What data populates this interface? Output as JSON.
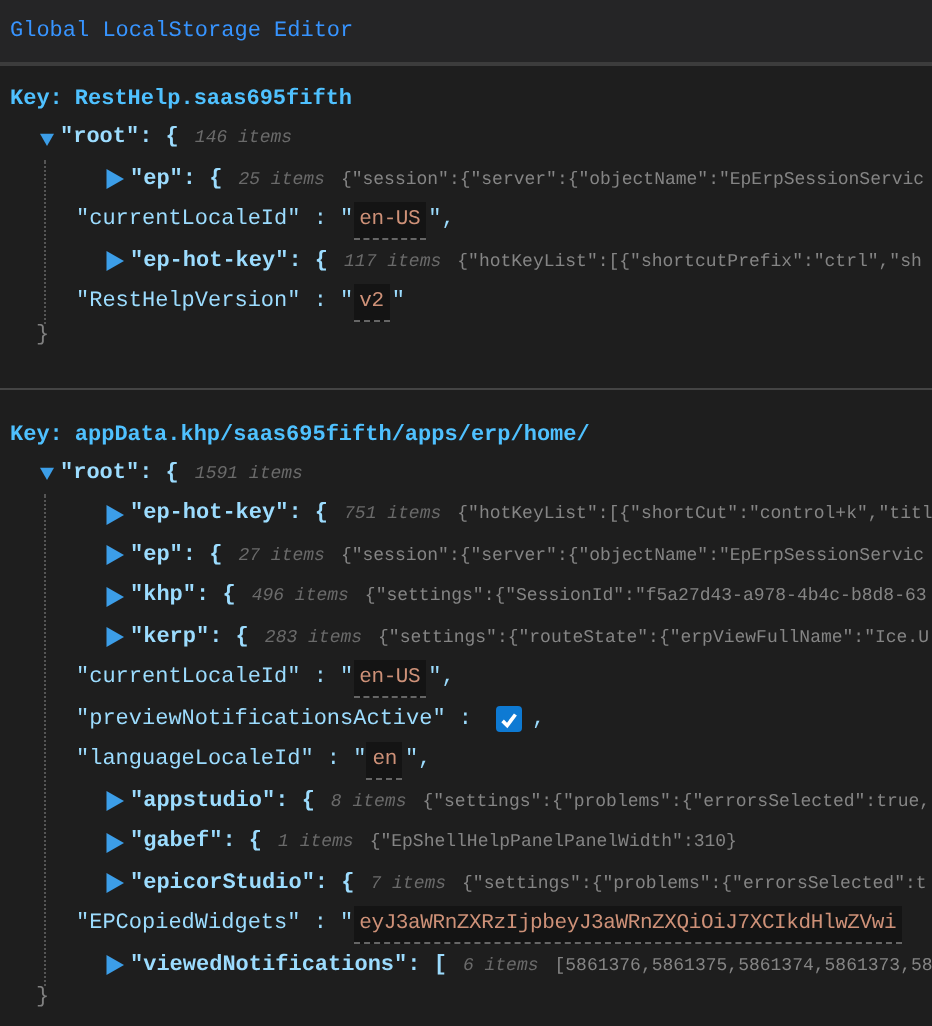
{
  "title": "Global LocalStorage Editor",
  "sections": [
    {
      "key_label": "Key:",
      "key": "RestHelp.saas695fifth",
      "root": {
        "label": "\"root\": {",
        "count": "146 items",
        "expanded": true
      },
      "close": "}",
      "items": [
        {
          "kind": "object",
          "label": "\"ep\": {",
          "count": "25 items",
          "expanded": false,
          "preview": "{\"session\":{\"server\":{\"objectName\":\"EpErpSessionServic"
        },
        {
          "kind": "string",
          "label": "\"currentLocaleId\" : \"",
          "value": "en-US",
          "suffix": "\","
        },
        {
          "kind": "object",
          "label": "\"ep-hot-key\": {",
          "count": "117 items",
          "expanded": false,
          "preview": "{\"hotKeyList\":[{\"shortcutPrefix\":\"ctrl\",\"sh"
        },
        {
          "kind": "string",
          "label": "\"RestHelpVersion\" : \"",
          "value": "v2",
          "suffix": "\""
        }
      ]
    },
    {
      "key_label": "Key:",
      "key": "appData.khp/saas695fifth/apps/erp/home/",
      "root": {
        "label": "\"root\": {",
        "count": "1591 items",
        "expanded": true
      },
      "close": "}",
      "items": [
        {
          "kind": "object",
          "label": "\"ep-hot-key\": {",
          "count": "751 items",
          "expanded": false,
          "preview": "{\"hotKeyList\":[{\"shortCut\":\"control+k\",\"titl"
        },
        {
          "kind": "object",
          "label": "\"ep\": {",
          "count": "27 items",
          "expanded": false,
          "preview": "{\"session\":{\"server\":{\"objectName\":\"EpErpSessionServic"
        },
        {
          "kind": "object",
          "label": "\"khp\": {",
          "count": "496 items",
          "expanded": false,
          "preview": "{\"settings\":{\"SessionId\":\"f5a27d43-a978-4b4c-b8d8-63"
        },
        {
          "kind": "object",
          "label": "\"kerp\": {",
          "count": "283 items",
          "expanded": false,
          "preview": "{\"settings\":{\"routeState\":{\"erpViewFullName\":\"Ice.U"
        },
        {
          "kind": "string",
          "label": "\"currentLocaleId\" : \"",
          "value": "en-US",
          "suffix": "\","
        },
        {
          "kind": "boolean",
          "label": "\"previewNotificationsActive\" :",
          "checked": true,
          "suffix": ","
        },
        {
          "kind": "string",
          "label": "\"languageLocaleId\" : \"",
          "value": "en",
          "suffix": "\","
        },
        {
          "kind": "object",
          "label": "\"appstudio\": {",
          "count": "8 items",
          "expanded": false,
          "preview": "{\"settings\":{\"problems\":{\"errorsSelected\":true,"
        },
        {
          "kind": "object",
          "label": "\"gabef\": {",
          "count": "1 items",
          "expanded": false,
          "preview": "{\"EpShellHelpPanelPanelWidth\":310}"
        },
        {
          "kind": "object",
          "label": "\"epicorStudio\": {",
          "count": "7 items",
          "expanded": false,
          "preview": "{\"settings\":{\"problems\":{\"errorsSelected\":t"
        },
        {
          "kind": "string",
          "label": "\"EPCopiedWidgets\" : \"",
          "value": "eyJ3aWRnZXRzIjpbeyJ3aWRnZXQiOiJ7XCIkdHlwZVwi"
        },
        {
          "kind": "object",
          "label": "\"viewedNotifications\": [",
          "count": "6 items",
          "expanded": false,
          "preview": "[5861376,5861375,5861374,5861373,58"
        }
      ]
    }
  ]
}
